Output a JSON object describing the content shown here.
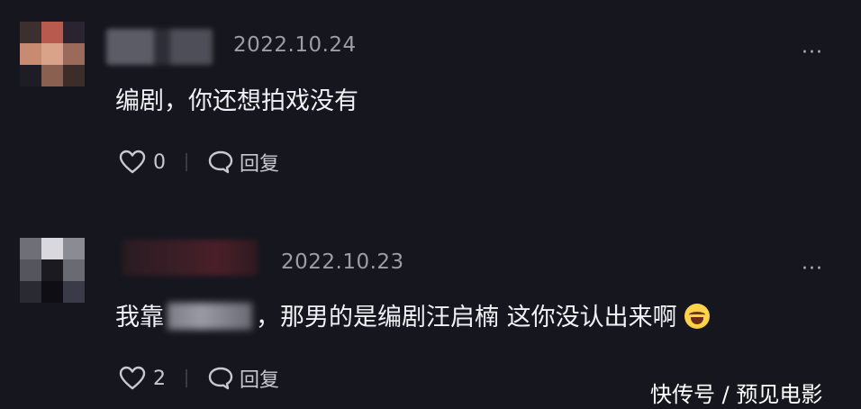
{
  "comments": [
    {
      "date": "2022.10.24",
      "text": "编剧，你还想拍戏没有",
      "likes": "0",
      "reply_label": "回复",
      "more_label": "···"
    },
    {
      "date": "2022.10.23",
      "text_prefix": "我靠",
      "text_suffix": "，那男的是编剧汪启楠 这你没认出来啊",
      "likes": "2",
      "reply_label": "回复",
      "more_label": "···",
      "emoji": "laughing-crying-emoji"
    }
  ],
  "watermark": "快传号 / 预见电影",
  "colors": {
    "background": "#16161e",
    "text": "#f1f1f5",
    "date": "#9d9da6",
    "icon": "#c8c8d0"
  }
}
